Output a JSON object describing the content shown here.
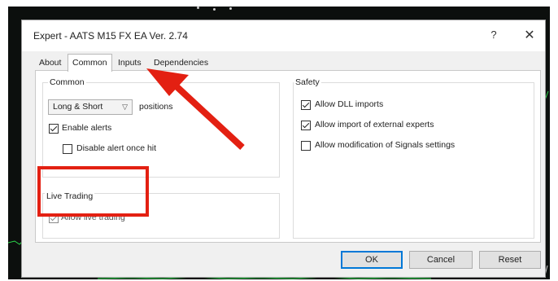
{
  "window": {
    "title": "Expert - AATS M15 FX EA Ver. 2.74",
    "help_label": "?",
    "close_label": "✕"
  },
  "tabs": [
    {
      "label": "About",
      "active": false
    },
    {
      "label": "Common",
      "active": true
    },
    {
      "label": "Inputs",
      "active": false
    },
    {
      "label": "Dependencies",
      "active": false
    }
  ],
  "common_group": {
    "title": "Common",
    "positions_select": {
      "value": "Long & Short"
    },
    "positions_label": "positions",
    "enable_alerts": {
      "label": "Enable alerts",
      "checked": true
    },
    "disable_alert": {
      "label": "Disable alert once hit",
      "checked": false
    }
  },
  "live_group": {
    "title": "Live Trading",
    "allow_live": {
      "label": "Allow live trading",
      "checked": true
    }
  },
  "safety_group": {
    "title": "Safety",
    "allow_dll": {
      "label": "Allow DLL imports",
      "checked": true
    },
    "allow_external": {
      "label": "Allow import of external experts",
      "checked": true
    },
    "allow_signals": {
      "label": "Allow modification of Signals settings",
      "checked": false
    }
  },
  "buttons": {
    "ok": "OK",
    "cancel": "Cancel",
    "reset": "Reset"
  },
  "annotation": {
    "color": "#e32012",
    "arrow_target": "Inputs tab",
    "box_target": "Live Trading group"
  }
}
